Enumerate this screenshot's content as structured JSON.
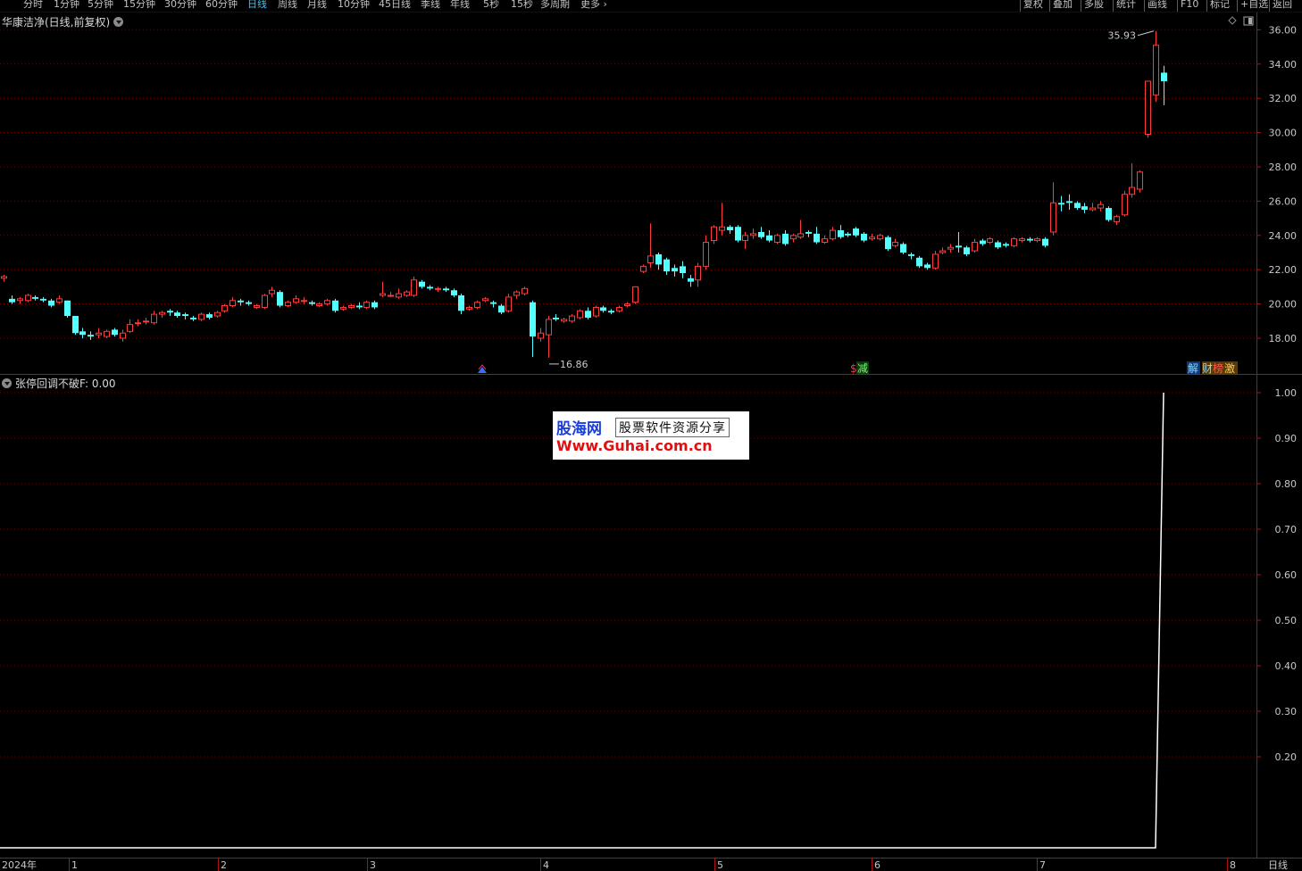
{
  "toolbar": {
    "periods": [
      "分时",
      "1分钟",
      "5分钟",
      "15分钟",
      "30分钟",
      "60分钟",
      "日线",
      "周线",
      "月线",
      "10分钟",
      "45日线",
      "季线",
      "年线",
      "5秒",
      "15秒",
      "多周期",
      "更多"
    ],
    "active_period": "日线",
    "right_buttons": [
      "复权",
      "叠加",
      "多股",
      "统计",
      "画线",
      "F10",
      "标记",
      "+自选",
      "返回"
    ]
  },
  "main_chart": {
    "title": "华康洁净(日线,前复权)",
    "price_axis": [
      "36.00",
      "34.00",
      "32.00",
      "30.00",
      "28.00",
      "26.00",
      "24.00",
      "22.00",
      "20.00",
      "18.00"
    ],
    "high_label": "35.93",
    "low_label": "16.86",
    "event_tags": {
      "reduce": "减",
      "unlock": "解",
      "rank1": "财",
      "rank2": "榜",
      "rank3": "激",
      "dollar": "$"
    }
  },
  "sub_chart": {
    "title": "张停回调不破F",
    "value": ": 0.00",
    "axis": [
      "1.00",
      "0.90",
      "0.80",
      "0.70",
      "0.60",
      "0.50",
      "0.40",
      "0.30",
      "0.20"
    ]
  },
  "date_axis": {
    "year": "2024年",
    "months": [
      "1",
      "2",
      "3",
      "4",
      "5",
      "6",
      "7",
      "8"
    ],
    "period_label": "日线"
  },
  "watermark": {
    "brand": "股海网",
    "slogan": "股票软件资源分享",
    "url": "Www.Guhai.com.cn"
  },
  "colors": {
    "up": "#ff3b3b",
    "down": "#54ffff",
    "grid": "#7a0000",
    "axis": "#b01010",
    "text": "#c8c8c8"
  },
  "chart_data": {
    "type": "candlestick",
    "title": "华康洁净(日线,前复权)",
    "ylim": [
      16.5,
      37
    ],
    "candles": [
      {
        "o": 21.5,
        "h": 21.7,
        "c": 21.6,
        "l": 21.3
      },
      {
        "o": 20.3,
        "h": 20.5,
        "c": 20.1,
        "l": 20.0
      },
      {
        "o": 20.2,
        "h": 20.4,
        "c": 20.3,
        "l": 20.0
      },
      {
        "o": 20.2,
        "h": 20.6,
        "c": 20.5,
        "l": 20.1
      },
      {
        "o": 20.4,
        "h": 20.5,
        "c": 20.3,
        "l": 20.2
      },
      {
        "o": 20.3,
        "h": 20.4,
        "c": 20.2,
        "l": 20.1
      },
      {
        "o": 20.2,
        "h": 20.3,
        "c": 19.9,
        "l": 19.8
      },
      {
        "o": 20.1,
        "h": 20.5,
        "c": 20.3,
        "l": 20.0
      },
      {
        "o": 20.2,
        "h": 20.2,
        "c": 19.3,
        "l": 19.2
      },
      {
        "o": 19.3,
        "h": 19.3,
        "c": 18.3,
        "l": 18.2
      },
      {
        "o": 18.4,
        "h": 18.6,
        "c": 18.2,
        "l": 18.0
      },
      {
        "o": 18.2,
        "h": 18.4,
        "c": 18.1,
        "l": 17.9
      },
      {
        "o": 18.2,
        "h": 18.6,
        "c": 18.3,
        "l": 18.0
      },
      {
        "o": 18.1,
        "h": 18.5,
        "c": 18.4,
        "l": 18.0
      },
      {
        "o": 18.5,
        "h": 18.6,
        "c": 18.2,
        "l": 18.1
      },
      {
        "o": 18.0,
        "h": 18.5,
        "c": 18.3,
        "l": 17.8
      },
      {
        "o": 18.4,
        "h": 19.1,
        "c": 18.8,
        "l": 18.3
      },
      {
        "o": 18.9,
        "h": 19.1,
        "c": 18.9,
        "l": 18.7
      },
      {
        "o": 19.0,
        "h": 19.2,
        "c": 19.0,
        "l": 18.8
      },
      {
        "o": 18.9,
        "h": 19.6,
        "c": 19.4,
        "l": 18.8
      },
      {
        "o": 19.4,
        "h": 19.6,
        "c": 19.5,
        "l": 19.2
      },
      {
        "o": 19.6,
        "h": 19.7,
        "c": 19.5,
        "l": 19.3
      },
      {
        "o": 19.5,
        "h": 19.6,
        "c": 19.3,
        "l": 19.2
      },
      {
        "o": 19.4,
        "h": 19.5,
        "c": 19.3,
        "l": 19.1
      },
      {
        "o": 19.2,
        "h": 19.3,
        "c": 19.1,
        "l": 19.0
      },
      {
        "o": 19.1,
        "h": 19.5,
        "c": 19.4,
        "l": 19.0
      },
      {
        "o": 19.4,
        "h": 19.5,
        "c": 19.2,
        "l": 19.1
      },
      {
        "o": 19.3,
        "h": 19.6,
        "c": 19.5,
        "l": 19.2
      },
      {
        "o": 19.6,
        "h": 20.0,
        "c": 19.9,
        "l": 19.5
      },
      {
        "o": 19.9,
        "h": 20.4,
        "c": 20.2,
        "l": 19.8
      },
      {
        "o": 20.2,
        "h": 20.3,
        "c": 20.1,
        "l": 19.9
      },
      {
        "o": 20.1,
        "h": 20.2,
        "c": 20.0,
        "l": 19.9
      },
      {
        "o": 19.8,
        "h": 20.0,
        "c": 19.9,
        "l": 19.7
      },
      {
        "o": 19.8,
        "h": 20.6,
        "c": 20.5,
        "l": 19.7
      },
      {
        "o": 20.6,
        "h": 21.0,
        "c": 20.8,
        "l": 20.4
      },
      {
        "o": 20.7,
        "h": 20.8,
        "c": 19.9,
        "l": 19.8
      },
      {
        "o": 19.9,
        "h": 20.2,
        "c": 20.1,
        "l": 19.8
      },
      {
        "o": 20.1,
        "h": 20.5,
        "c": 20.3,
        "l": 20.0
      },
      {
        "o": 20.2,
        "h": 20.4,
        "c": 20.2,
        "l": 20.0
      },
      {
        "o": 20.1,
        "h": 20.2,
        "c": 20.0,
        "l": 19.9
      },
      {
        "o": 19.9,
        "h": 20.1,
        "c": 20.0,
        "l": 19.8
      },
      {
        "o": 20.0,
        "h": 20.3,
        "c": 20.2,
        "l": 19.9
      },
      {
        "o": 20.2,
        "h": 20.3,
        "c": 19.6,
        "l": 19.5
      },
      {
        "o": 19.7,
        "h": 19.9,
        "c": 19.8,
        "l": 19.6
      },
      {
        "o": 19.8,
        "h": 20.0,
        "c": 19.9,
        "l": 19.7
      },
      {
        "o": 19.9,
        "h": 20.1,
        "c": 19.8,
        "l": 19.7
      },
      {
        "o": 19.8,
        "h": 20.2,
        "c": 20.1,
        "l": 19.7
      },
      {
        "o": 20.1,
        "h": 20.2,
        "c": 19.8,
        "l": 19.7
      },
      {
        "o": 20.5,
        "h": 21.3,
        "c": 20.6,
        "l": 20.4
      },
      {
        "o": 20.5,
        "h": 20.7,
        "c": 20.5,
        "l": 20.4
      },
      {
        "o": 20.4,
        "h": 20.9,
        "c": 20.6,
        "l": 20.3
      },
      {
        "o": 20.5,
        "h": 20.8,
        "c": 20.7,
        "l": 20.4
      },
      {
        "o": 20.5,
        "h": 21.6,
        "c": 21.4,
        "l": 20.4
      },
      {
        "o": 21.3,
        "h": 21.4,
        "c": 21.0,
        "l": 20.9
      },
      {
        "o": 21.0,
        "h": 21.1,
        "c": 20.9,
        "l": 20.8
      },
      {
        "o": 20.9,
        "h": 21.0,
        "c": 20.9,
        "l": 20.7
      },
      {
        "o": 20.9,
        "h": 21.0,
        "c": 20.8,
        "l": 20.7
      },
      {
        "o": 20.8,
        "h": 20.9,
        "c": 20.5,
        "l": 20.4
      },
      {
        "o": 20.5,
        "h": 20.6,
        "c": 19.6,
        "l": 19.4
      },
      {
        "o": 19.7,
        "h": 19.9,
        "c": 19.8,
        "l": 19.6
      },
      {
        "o": 19.8,
        "h": 20.2,
        "c": 20.1,
        "l": 19.7
      },
      {
        "o": 20.2,
        "h": 20.4,
        "c": 20.3,
        "l": 20.1
      },
      {
        "o": 20.1,
        "h": 20.2,
        "c": 20.0,
        "l": 19.8
      },
      {
        "o": 19.9,
        "h": 20.0,
        "c": 19.5,
        "l": 19.4
      },
      {
        "o": 19.6,
        "h": 20.6,
        "c": 20.4,
        "l": 19.5
      },
      {
        "o": 20.5,
        "h": 20.8,
        "c": 20.7,
        "l": 20.3
      },
      {
        "o": 20.6,
        "h": 21.0,
        "c": 20.9,
        "l": 20.5
      },
      {
        "o": 20.1,
        "h": 20.2,
        "c": 18.1,
        "l": 16.9
      },
      {
        "o": 18.0,
        "h": 18.6,
        "c": 18.3,
        "l": 17.8
      },
      {
        "o": 18.2,
        "h": 19.3,
        "c": 19.1,
        "l": 16.86
      },
      {
        "o": 19.2,
        "h": 19.4,
        "c": 19.1,
        "l": 19.0
      },
      {
        "o": 19.0,
        "h": 19.2,
        "c": 19.1,
        "l": 18.9
      },
      {
        "o": 19.0,
        "h": 19.4,
        "c": 19.3,
        "l": 18.9
      },
      {
        "o": 19.2,
        "h": 19.7,
        "c": 19.6,
        "l": 19.1
      },
      {
        "o": 19.6,
        "h": 19.8,
        "c": 19.2,
        "l": 19.1
      },
      {
        "o": 19.3,
        "h": 19.9,
        "c": 19.8,
        "l": 19.2
      },
      {
        "o": 19.8,
        "h": 19.9,
        "c": 19.6,
        "l": 19.5
      },
      {
        "o": 19.6,
        "h": 19.7,
        "c": 19.5,
        "l": 19.4
      },
      {
        "o": 19.6,
        "h": 19.9,
        "c": 19.8,
        "l": 19.5
      },
      {
        "o": 19.9,
        "h": 20.1,
        "c": 20.0,
        "l": 19.8
      },
      {
        "o": 20.1,
        "h": 21.0,
        "c": 21.0,
        "l": 20.0
      },
      {
        "o": 21.9,
        "h": 22.3,
        "c": 22.2,
        "l": 21.8
      },
      {
        "o": 22.4,
        "h": 24.7,
        "c": 22.8,
        "l": 22.1
      },
      {
        "o": 22.9,
        "h": 23.0,
        "c": 22.3,
        "l": 22.0
      },
      {
        "o": 22.6,
        "h": 22.7,
        "c": 21.9,
        "l": 21.7
      },
      {
        "o": 22.1,
        "h": 22.3,
        "c": 21.9,
        "l": 21.6
      },
      {
        "o": 22.2,
        "h": 22.5,
        "c": 21.8,
        "l": 21.5
      },
      {
        "o": 21.5,
        "h": 21.7,
        "c": 21.3,
        "l": 21.0
      },
      {
        "o": 21.4,
        "h": 22.4,
        "c": 22.2,
        "l": 21.0
      },
      {
        "o": 22.2,
        "h": 24.0,
        "c": 23.6,
        "l": 22.0
      },
      {
        "o": 23.7,
        "h": 24.6,
        "c": 24.5,
        "l": 23.5
      },
      {
        "o": 24.3,
        "h": 25.9,
        "c": 24.5,
        "l": 24.0
      },
      {
        "o": 24.5,
        "h": 24.6,
        "c": 24.3,
        "l": 24.1
      },
      {
        "o": 24.5,
        "h": 24.6,
        "c": 23.7,
        "l": 23.6
      },
      {
        "o": 23.7,
        "h": 24.2,
        "c": 24.0,
        "l": 23.2
      },
      {
        "o": 24.0,
        "h": 24.4,
        "c": 24.1,
        "l": 23.8
      },
      {
        "o": 24.2,
        "h": 24.5,
        "c": 23.9,
        "l": 23.8
      },
      {
        "o": 24.0,
        "h": 24.3,
        "c": 23.7,
        "l": 23.6
      },
      {
        "o": 23.6,
        "h": 24.1,
        "c": 24.0,
        "l": 23.5
      },
      {
        "o": 24.1,
        "h": 24.3,
        "c": 23.5,
        "l": 23.4
      },
      {
        "o": 23.8,
        "h": 24.1,
        "c": 24.0,
        "l": 23.6
      },
      {
        "o": 23.9,
        "h": 24.9,
        "c": 24.1,
        "l": 23.8
      },
      {
        "o": 24.2,
        "h": 24.3,
        "c": 24.1,
        "l": 23.9
      },
      {
        "o": 24.1,
        "h": 24.5,
        "c": 23.6,
        "l": 23.5
      },
      {
        "o": 23.6,
        "h": 24.0,
        "c": 23.8,
        "l": 23.5
      },
      {
        "o": 23.8,
        "h": 24.5,
        "c": 24.3,
        "l": 23.7
      },
      {
        "o": 24.3,
        "h": 24.6,
        "c": 23.9,
        "l": 23.8
      },
      {
        "o": 24.1,
        "h": 24.2,
        "c": 24.0,
        "l": 23.9
      },
      {
        "o": 24.4,
        "h": 24.5,
        "c": 24.0,
        "l": 23.9
      },
      {
        "o": 24.1,
        "h": 24.2,
        "c": 23.7,
        "l": 23.6
      },
      {
        "o": 23.8,
        "h": 24.1,
        "c": 23.9,
        "l": 23.7
      },
      {
        "o": 23.8,
        "h": 24.1,
        "c": 24.0,
        "l": 23.7
      },
      {
        "o": 23.9,
        "h": 24.0,
        "c": 23.2,
        "l": 23.1
      },
      {
        "o": 23.4,
        "h": 23.8,
        "c": 23.6,
        "l": 23.3
      },
      {
        "o": 23.5,
        "h": 23.6,
        "c": 23.0,
        "l": 22.9
      },
      {
        "o": 22.9,
        "h": 23.0,
        "c": 22.8,
        "l": 22.6
      },
      {
        "o": 22.7,
        "h": 22.8,
        "c": 22.2,
        "l": 22.1
      },
      {
        "o": 22.3,
        "h": 22.4,
        "c": 22.1,
        "l": 22.0
      },
      {
        "o": 22.1,
        "h": 23.1,
        "c": 22.9,
        "l": 22.0
      },
      {
        "o": 23.0,
        "h": 23.3,
        "c": 23.1,
        "l": 22.9
      },
      {
        "o": 23.2,
        "h": 23.5,
        "c": 23.3,
        "l": 23.0
      },
      {
        "o": 23.4,
        "h": 24.2,
        "c": 23.3,
        "l": 23.0
      },
      {
        "o": 23.3,
        "h": 23.4,
        "c": 22.9,
        "l": 22.8
      },
      {
        "o": 23.1,
        "h": 23.8,
        "c": 23.6,
        "l": 23.0
      },
      {
        "o": 23.7,
        "h": 23.8,
        "c": 23.5,
        "l": 23.4
      },
      {
        "o": 23.6,
        "h": 23.9,
        "c": 23.8,
        "l": 23.5
      },
      {
        "o": 23.6,
        "h": 23.7,
        "c": 23.3,
        "l": 23.2
      },
      {
        "o": 23.5,
        "h": 23.6,
        "c": 23.4,
        "l": 23.3
      },
      {
        "o": 23.4,
        "h": 23.9,
        "c": 23.8,
        "l": 23.3
      },
      {
        "o": 23.7,
        "h": 23.9,
        "c": 23.8,
        "l": 23.6
      },
      {
        "o": 23.8,
        "h": 23.9,
        "c": 23.7,
        "l": 23.6
      },
      {
        "o": 23.7,
        "h": 23.9,
        "c": 23.8,
        "l": 23.6
      },
      {
        "o": 23.8,
        "h": 23.9,
        "c": 23.4,
        "l": 23.3
      },
      {
        "o": 24.2,
        "h": 27.1,
        "c": 25.9,
        "l": 24.0
      },
      {
        "o": 25.9,
        "h": 26.3,
        "c": 25.8,
        "l": 25.4
      },
      {
        "o": 26.0,
        "h": 26.4,
        "c": 25.9,
        "l": 25.5
      },
      {
        "o": 25.9,
        "h": 26.0,
        "c": 25.6,
        "l": 25.5
      },
      {
        "o": 25.7,
        "h": 25.9,
        "c": 25.5,
        "l": 25.3
      },
      {
        "o": 25.5,
        "h": 25.9,
        "c": 25.6,
        "l": 25.4
      },
      {
        "o": 25.6,
        "h": 26.0,
        "c": 25.8,
        "l": 25.4
      },
      {
        "o": 25.6,
        "h": 25.7,
        "c": 24.9,
        "l": 24.8
      },
      {
        "o": 24.8,
        "h": 25.2,
        "c": 25.1,
        "l": 24.6
      },
      {
        "o": 25.2,
        "h": 26.6,
        "c": 26.4,
        "l": 25.1
      },
      {
        "o": 26.4,
        "h": 28.2,
        "c": 26.8,
        "l": 26.2
      },
      {
        "o": 26.7,
        "h": 27.8,
        "c": 27.7,
        "l": 26.5
      },
      {
        "o": 29.9,
        "h": 33.0,
        "c": 33.0,
        "l": 29.7
      },
      {
        "o": 32.2,
        "h": 35.93,
        "c": 35.1,
        "l": 31.8
      },
      {
        "o": 33.5,
        "h": 33.9,
        "c": 33.0,
        "l": 31.6
      }
    ],
    "sub_series": {
      "name": "张停回调不破F",
      "values": [
        0,
        0,
        1
      ]
    }
  }
}
